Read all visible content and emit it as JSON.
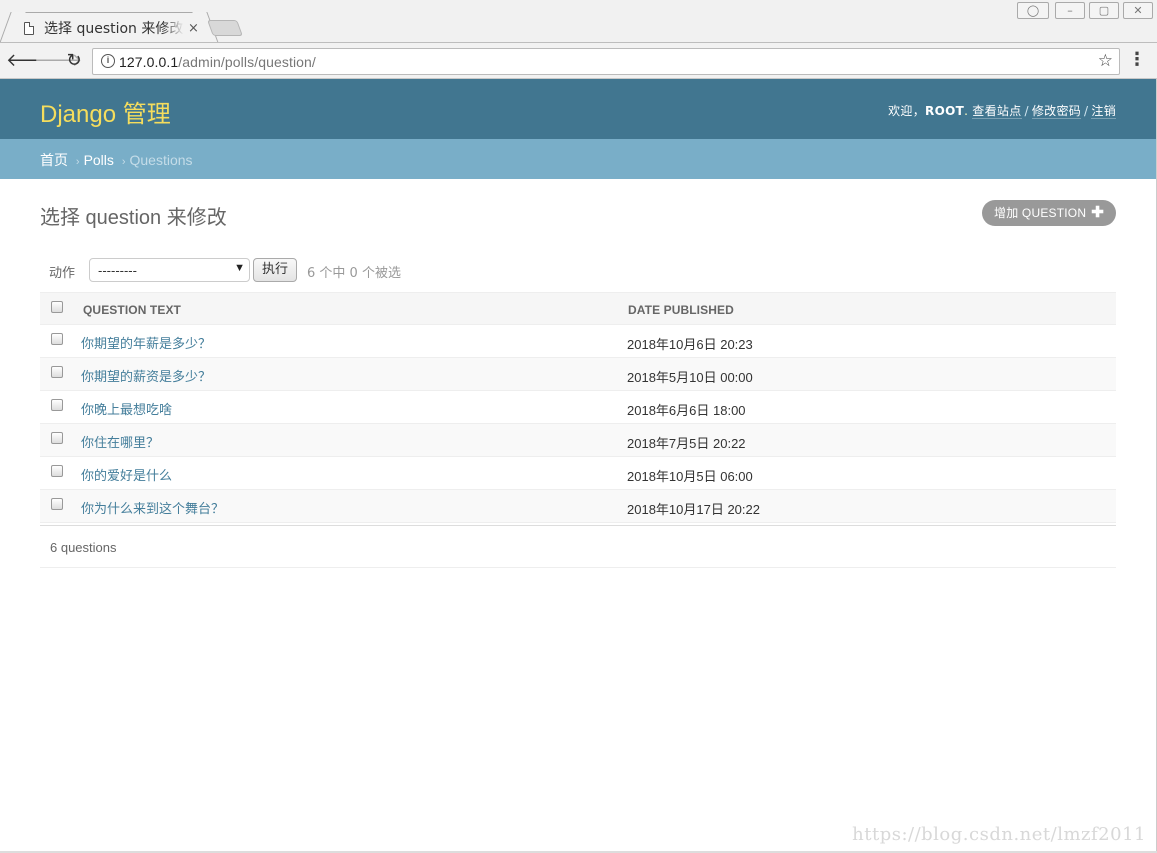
{
  "browser": {
    "tab_title": "选择 question 来修改",
    "tab_close": "×",
    "url_host": "127.0.0.1",
    "url_path": "/admin/polls/question/"
  },
  "header": {
    "brand": "Django 管理",
    "welcome": "欢迎，",
    "username": "ROOT",
    "view_site": "查看站点",
    "change_password": "修改密码",
    "logout": "注销",
    "separator": "/"
  },
  "breadcrumbs": {
    "home": "首页",
    "app": "Polls",
    "current": "Questions",
    "arrow": "›"
  },
  "main": {
    "title": "选择 question 来修改",
    "add_button": "增加 QUESTION",
    "add_icon": "✚"
  },
  "actions": {
    "label": "动作",
    "select_value": "---------",
    "go_label": "执行",
    "counter": "6 个中 0 个被选"
  },
  "table": {
    "headers": [
      "QUESTION TEXT",
      "DATE PUBLISHED"
    ],
    "rows": [
      {
        "question": "你期望的年薪是多少？",
        "date": "2018年10月6日 20:23"
      },
      {
        "question": "你期望的薪资是多少？",
        "date": "2018年5月10日 00:00"
      },
      {
        "question": "你晚上最想吃啥",
        "date": "2018年6月6日 18:00"
      },
      {
        "question": "你住在哪里？",
        "date": "2018年7月5日 20:22"
      },
      {
        "question": "你的爱好是什么",
        "date": "2018年10月5日 06:00"
      },
      {
        "question": "你为什么来到这个舞台？",
        "date": "2018年10月17日 20:22"
      }
    ]
  },
  "paginator": "6 questions",
  "watermark": "https://blog.csdn.net/lmzf2011",
  "colors": {
    "header_bg": "#417690",
    "brand": "#f5dd5d",
    "breadcrumbs_bg": "#79aec8",
    "link": "#447e9b"
  }
}
